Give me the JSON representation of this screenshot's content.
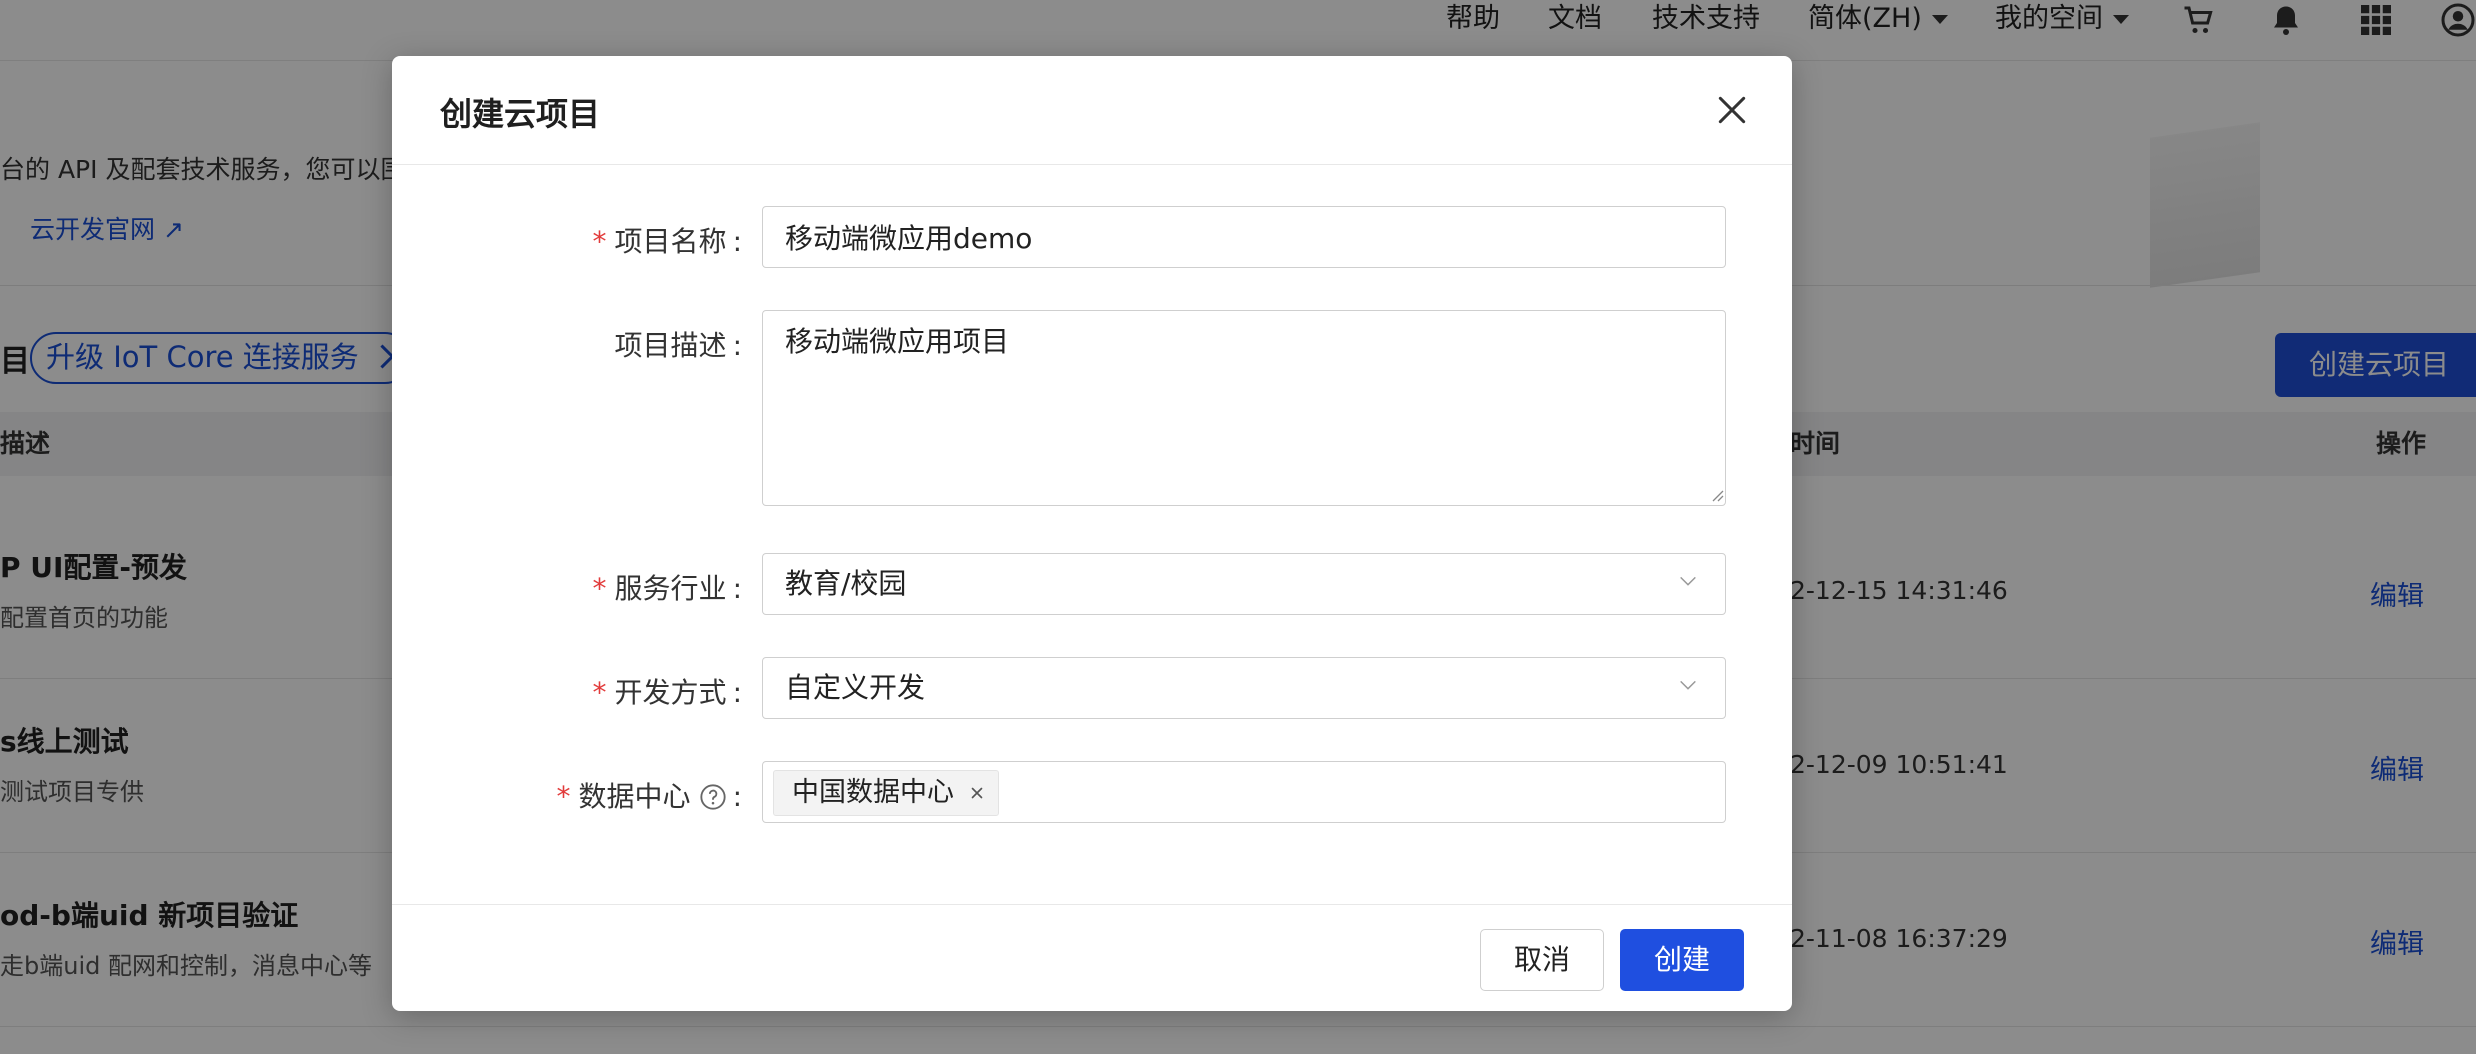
{
  "topbar": {
    "nav": [
      "帮助",
      "文档",
      "技术支持"
    ],
    "language": "简体(ZH)",
    "space": "我的空间",
    "icons": [
      "cart-icon",
      "bell-icon",
      "apps-grid-icon",
      "user-avatar-icon"
    ]
  },
  "intro": {
    "text": "台的 API 及配套技术服务，您可以围绕",
    "official_link": "云开发官网"
  },
  "section": {
    "title_tail": "目",
    "upgrade_label": "升级 IoT Core 连接服务",
    "create_button": "创建云项目"
  },
  "table": {
    "headers": {
      "desc": "描述",
      "time": "时间",
      "actions": "操作"
    },
    "rows": [
      {
        "name": "P UI配置-预发",
        "desc": "配置首页的功能",
        "time": "2-12-15 14:31:46",
        "action": "编辑"
      },
      {
        "name": "s线上测试",
        "desc": "测试项目专供",
        "time": "2-12-09 10:51:41",
        "action": "编辑"
      },
      {
        "name": "od-b端uid 新项目验证",
        "desc": "走b端uid 配网和控制，消息中心等",
        "time": "2-11-08 16:37:29",
        "action": "编辑"
      }
    ]
  },
  "modal": {
    "title": "创建云项目",
    "required_mark": "*",
    "colon": ":",
    "fields": {
      "name": {
        "label": "项目名称",
        "value": "移动端微应用demo"
      },
      "description": {
        "label": "项目描述",
        "value": "移动端微应用项目"
      },
      "industry": {
        "label": "服务行业",
        "value": "教育/校园"
      },
      "dev_mode": {
        "label": "开发方式",
        "value": "自定义开发"
      },
      "data_center": {
        "label": "数据中心",
        "tag": "中国数据中心"
      }
    },
    "cancel_label": "取消",
    "create_label": "创建"
  },
  "colors": {
    "primary": "#1f4fe0",
    "link": "#1a4fd6",
    "required": "#e23b3b",
    "overlay": "rgba(0,0,0,0.45)"
  }
}
